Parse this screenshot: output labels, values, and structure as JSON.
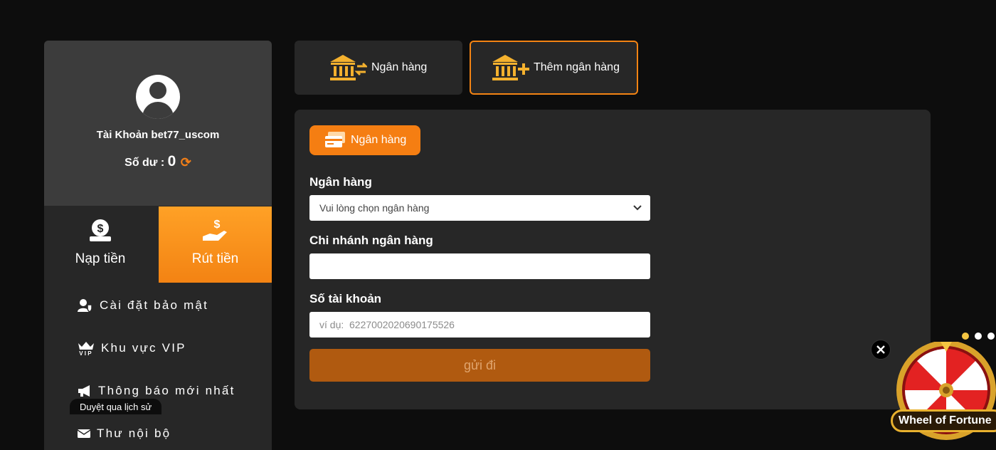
{
  "profile": {
    "account_label": "Tài Khoản",
    "username": "bet77_uscom",
    "balance_label": "Số dư :",
    "balance_value": "0"
  },
  "actions": {
    "deposit_label": "Nạp tiền",
    "withdraw_label": "Rút tiền"
  },
  "menu": {
    "items": [
      {
        "label": "Cài đặt bảo mật",
        "icon": "user-shield-icon"
      },
      {
        "label": "Khu vực VIP",
        "icon": "vip-crown-icon"
      },
      {
        "label": "Thông báo mới nhất",
        "icon": "megaphone-icon"
      },
      {
        "label": "Thư nội bộ",
        "icon": "envelope-icon"
      }
    ],
    "tooltip": "Duyệt qua lịch sử"
  },
  "tabs": {
    "bank_label": "Ngân hàng",
    "add_bank_label": "Thêm ngân hàng"
  },
  "form": {
    "section_pill": "Ngân hàng",
    "bank_label": "Ngân hàng",
    "bank_placeholder": "Vui lòng chọn ngân hàng",
    "branch_label": "Chi nhánh ngân hàng",
    "branch_value": "",
    "account_label": "Số tài khoản",
    "account_placeholder": "ví dụ:  6227002020690175526",
    "submit_label": "gửi đi"
  },
  "widget": {
    "label": "Wheel of Fortune"
  },
  "colors": {
    "accent": "#f57e12",
    "panel": "#272727",
    "background": "#0d0d0d",
    "gold": "#f4b12e"
  }
}
